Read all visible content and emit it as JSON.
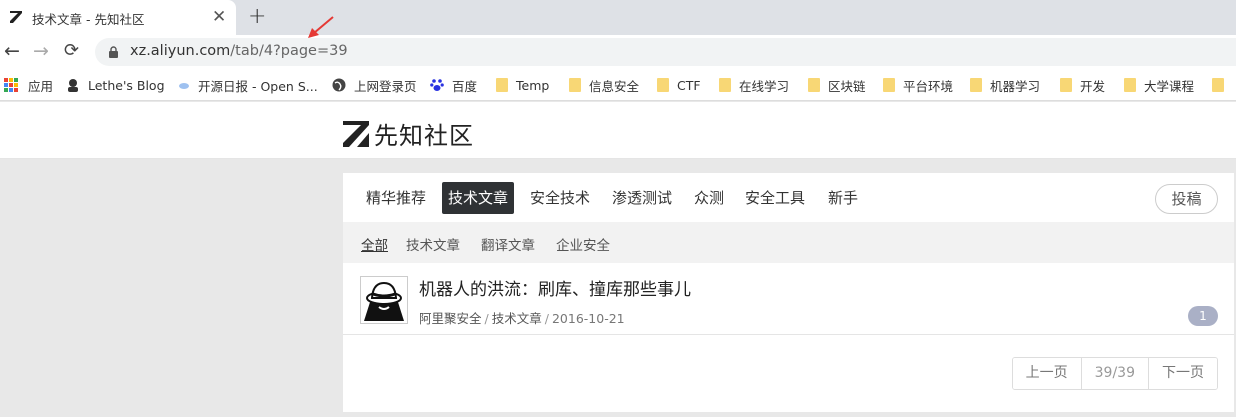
{
  "browser": {
    "tab_title": "技术文章 - 先知社区",
    "tab_close": "✕",
    "new_tab": "+",
    "back": "←",
    "forward": "→",
    "reload": "⟳",
    "url_host": "xz.aliyun.com",
    "url_path": "/tab/4?page=39",
    "accent_annotation_color": "#e53935",
    "bookmarks": [
      {
        "label": "应用",
        "icon": "apps-grid-icon"
      },
      {
        "label": "Lethe's Blog",
        "icon": "avatar-icon"
      },
      {
        "label": "开源日报 - Open S...",
        "icon": "cloud-icon"
      },
      {
        "label": "上网登录页",
        "icon": "globe-icon"
      },
      {
        "label": "百度",
        "icon": "baidu-paw-icon"
      },
      {
        "label": "Temp",
        "icon": "folder-icon"
      },
      {
        "label": "信息安全",
        "icon": "folder-icon"
      },
      {
        "label": "CTF",
        "icon": "folder-icon"
      },
      {
        "label": "在线学习",
        "icon": "folder-icon"
      },
      {
        "label": "区块链",
        "icon": "folder-icon"
      },
      {
        "label": "平台环境",
        "icon": "folder-icon"
      },
      {
        "label": "机器学习",
        "icon": "folder-icon"
      },
      {
        "label": "开发",
        "icon": "folder-icon"
      },
      {
        "label": "大学课程",
        "icon": "folder-icon"
      }
    ]
  },
  "site": {
    "name": "先知社区"
  },
  "nav": {
    "tabs": [
      "精华推荐",
      "技术文章",
      "安全技术",
      "渗透测试",
      "众测",
      "安全工具",
      "新手"
    ],
    "active_index": 1,
    "post_button": "投稿"
  },
  "subnav": {
    "tabs": [
      "全部",
      "技术文章",
      "翻译文章",
      "企业安全"
    ],
    "active_index": 0
  },
  "topics": [
    {
      "title": "机器人的洪流：刷库、撞库那些事儿",
      "author": "阿里聚安全",
      "category": "技术文章",
      "date": "2016-10-21",
      "replies": "1",
      "separator": "/"
    }
  ],
  "pagination": {
    "prev": "上一页",
    "current": "39/39",
    "next": "下一页"
  }
}
